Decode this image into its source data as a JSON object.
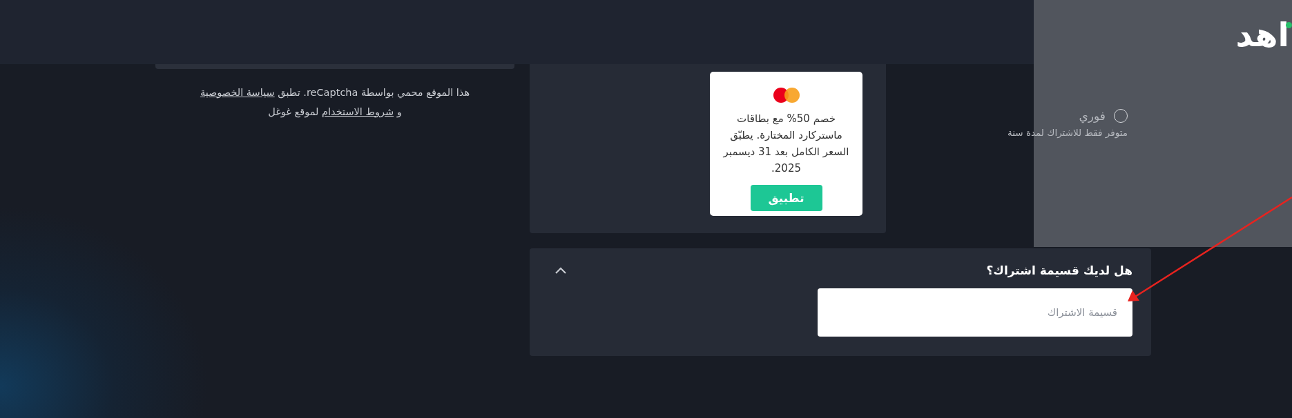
{
  "recaptcha_notice": {
    "before": "هذا الموقع محمي بواسطة reCaptcha. تطبق",
    "privacy_link": "سياسة الخصوصية",
    "middle": "و",
    "terms_link": "شروط الاستخدام",
    "after": "لموقع غوغل"
  },
  "offer_card": {
    "text": "خصم 50% مع بطاقات ماستركارد المختارة. يطبّق السعر الكامل بعد 31 ديسمبر 2025.",
    "button": "تطبيق"
  },
  "voucher": {
    "title": "هل لديك قسيمة اشتراك؟",
    "expanded": true,
    "placeholder": "قسيمة الاشتراك"
  },
  "plan_panel": {
    "logo": "اهد",
    "option": {
      "label": "فوري",
      "subtitle": "متوفر فقط للاشتراك لمدة سنة",
      "selected": false
    }
  }
}
